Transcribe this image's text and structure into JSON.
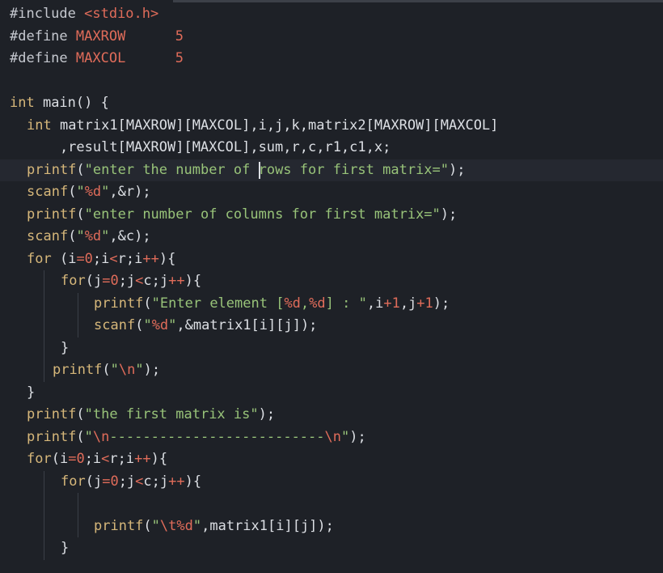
{
  "editor": {
    "language": "c",
    "cursor": {
      "line": 8,
      "column": 28
    },
    "lines": [
      {
        "tokens": [
          {
            "t": "#include ",
            "c": "pp"
          },
          {
            "t": "<stdio.h>",
            "c": "inc"
          }
        ]
      },
      {
        "tokens": [
          {
            "t": "#define ",
            "c": "pp"
          },
          {
            "t": "MAXROW",
            "c": "inc"
          },
          {
            "t": "      ",
            "c": "id"
          },
          {
            "t": "5",
            "c": "num"
          }
        ]
      },
      {
        "tokens": [
          {
            "t": "#define ",
            "c": "pp"
          },
          {
            "t": "MAXCOL",
            "c": "inc"
          },
          {
            "t": "      ",
            "c": "id"
          },
          {
            "t": "5",
            "c": "num"
          }
        ]
      },
      {
        "tokens": []
      },
      {
        "tokens": [
          {
            "t": "int ",
            "c": "kw"
          },
          {
            "t": "main() {",
            "c": "id"
          }
        ]
      },
      {
        "indent": 1,
        "tokens": [
          {
            "t": "int ",
            "c": "kw"
          },
          {
            "t": "matrix1[MAXROW][MAXCOL],i,j,k,matrix2[MAXROW][MAXCOL]",
            "c": "id"
          }
        ]
      },
      {
        "indent": 1,
        "tokens": [
          {
            "t": "    ,result[MAXROW][MAXCOL],sum,r,c,r1,c1,x;",
            "c": "id"
          }
        ]
      },
      {
        "indent": 1,
        "active": true,
        "tokens": [
          {
            "t": "printf",
            "c": "fn"
          },
          {
            "t": "(",
            "c": "id"
          },
          {
            "t": "\"enter the number of rows for first matrix=\"",
            "c": "str"
          },
          {
            "t": ");",
            "c": "id"
          }
        ]
      },
      {
        "indent": 1,
        "tokens": [
          {
            "t": "scanf",
            "c": "fn"
          },
          {
            "t": "(",
            "c": "id"
          },
          {
            "t": "\"",
            "c": "str"
          },
          {
            "t": "%d",
            "c": "esc"
          },
          {
            "t": "\"",
            "c": "str"
          },
          {
            "t": ",&r);",
            "c": "id"
          }
        ]
      },
      {
        "indent": 1,
        "tokens": [
          {
            "t": "printf",
            "c": "fn"
          },
          {
            "t": "(",
            "c": "id"
          },
          {
            "t": "\"enter number of columns for first matrix=\"",
            "c": "str"
          },
          {
            "t": ");",
            "c": "id"
          }
        ]
      },
      {
        "indent": 1,
        "tokens": [
          {
            "t": "scanf",
            "c": "fn"
          },
          {
            "t": "(",
            "c": "id"
          },
          {
            "t": "\"",
            "c": "str"
          },
          {
            "t": "%d",
            "c": "esc"
          },
          {
            "t": "\"",
            "c": "str"
          },
          {
            "t": ",&c);",
            "c": "id"
          }
        ]
      },
      {
        "indent": 1,
        "tokens": [
          {
            "t": "for ",
            "c": "kw"
          },
          {
            "t": "(i",
            "c": "id"
          },
          {
            "t": "=0",
            "c": "op"
          },
          {
            "t": ";i",
            "c": "id"
          },
          {
            "t": "<",
            "c": "op"
          },
          {
            "t": "r;i",
            "c": "id"
          },
          {
            "t": "++",
            "c": "op"
          },
          {
            "t": "){",
            "c": "id"
          }
        ]
      },
      {
        "indent": 2,
        "tokens": [
          {
            "t": "for",
            "c": "kw"
          },
          {
            "t": "(j",
            "c": "id"
          },
          {
            "t": "=0",
            "c": "op"
          },
          {
            "t": ";j",
            "c": "id"
          },
          {
            "t": "<",
            "c": "op"
          },
          {
            "t": "c;j",
            "c": "id"
          },
          {
            "t": "++",
            "c": "op"
          },
          {
            "t": "){",
            "c": "id"
          }
        ]
      },
      {
        "indent": 3,
        "tokens": [
          {
            "t": "printf",
            "c": "fn"
          },
          {
            "t": "(",
            "c": "id"
          },
          {
            "t": "\"Enter element [",
            "c": "str"
          },
          {
            "t": "%d",
            "c": "esc"
          },
          {
            "t": ",",
            "c": "str"
          },
          {
            "t": "%d",
            "c": "esc"
          },
          {
            "t": "] : \"",
            "c": "str"
          },
          {
            "t": ",i",
            "c": "id"
          },
          {
            "t": "+1",
            "c": "op"
          },
          {
            "t": ",j",
            "c": "id"
          },
          {
            "t": "+1",
            "c": "op"
          },
          {
            "t": ");",
            "c": "id"
          }
        ]
      },
      {
        "indent": 3,
        "tokens": [
          {
            "t": "scanf",
            "c": "fn"
          },
          {
            "t": "(",
            "c": "id"
          },
          {
            "t": "\"",
            "c": "str"
          },
          {
            "t": "%d",
            "c": "esc"
          },
          {
            "t": "\"",
            "c": "str"
          },
          {
            "t": ",&matrix1[i][j]);",
            "c": "id"
          }
        ]
      },
      {
        "indent": 2,
        "tokens": [
          {
            "t": "}",
            "c": "id"
          }
        ]
      },
      {
        "indent": 2,
        "shift": true,
        "tokens": [
          {
            "t": "printf",
            "c": "fn"
          },
          {
            "t": "(",
            "c": "id"
          },
          {
            "t": "\"",
            "c": "str"
          },
          {
            "t": "\\n",
            "c": "esc"
          },
          {
            "t": "\"",
            "c": "str"
          },
          {
            "t": ");",
            "c": "id"
          }
        ]
      },
      {
        "indent": 1,
        "tokens": [
          {
            "t": "}",
            "c": "id"
          }
        ]
      },
      {
        "indent": 1,
        "tokens": [
          {
            "t": "printf",
            "c": "fn"
          },
          {
            "t": "(",
            "c": "id"
          },
          {
            "t": "\"the first matrix is\"",
            "c": "str"
          },
          {
            "t": ");",
            "c": "id"
          }
        ]
      },
      {
        "indent": 1,
        "tokens": [
          {
            "t": "printf",
            "c": "fn"
          },
          {
            "t": "(",
            "c": "id"
          },
          {
            "t": "\"",
            "c": "str"
          },
          {
            "t": "\\n",
            "c": "esc"
          },
          {
            "t": "--------------------------",
            "c": "str"
          },
          {
            "t": "\\n",
            "c": "esc"
          },
          {
            "t": "\"",
            "c": "str"
          },
          {
            "t": ");",
            "c": "id"
          }
        ]
      },
      {
        "indent": 1,
        "tokens": [
          {
            "t": "for",
            "c": "kw"
          },
          {
            "t": "(i",
            "c": "id"
          },
          {
            "t": "=0",
            "c": "op"
          },
          {
            "t": ";i",
            "c": "id"
          },
          {
            "t": "<",
            "c": "op"
          },
          {
            "t": "r;i",
            "c": "id"
          },
          {
            "t": "++",
            "c": "op"
          },
          {
            "t": "){",
            "c": "id"
          }
        ]
      },
      {
        "indent": 2,
        "tokens": [
          {
            "t": "for",
            "c": "kw"
          },
          {
            "t": "(j",
            "c": "id"
          },
          {
            "t": "=0",
            "c": "op"
          },
          {
            "t": ";j",
            "c": "id"
          },
          {
            "t": "<",
            "c": "op"
          },
          {
            "t": "c;j",
            "c": "id"
          },
          {
            "t": "++",
            "c": "op"
          },
          {
            "t": "){",
            "c": "id"
          }
        ]
      },
      {
        "indent": 3,
        "tokens": []
      },
      {
        "indent": 3,
        "tokens": [
          {
            "t": "printf",
            "c": "fn"
          },
          {
            "t": "(",
            "c": "id"
          },
          {
            "t": "\"",
            "c": "str"
          },
          {
            "t": "\\t%d",
            "c": "esc"
          },
          {
            "t": "\"",
            "c": "str"
          },
          {
            "t": ",matrix1[i][j]);",
            "c": "id"
          }
        ]
      },
      {
        "indent": 2,
        "tokens": [
          {
            "t": "}",
            "c": "id"
          }
        ]
      }
    ]
  },
  "colors": {
    "background": "#1e2127",
    "active_line": "#252830",
    "keyword": "#d6b77a",
    "string": "#98c379",
    "number": "#e06c5a"
  }
}
